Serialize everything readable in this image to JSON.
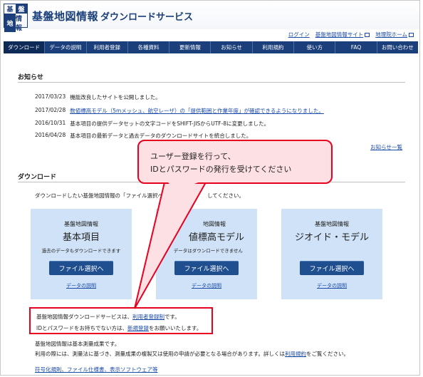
{
  "header": {
    "logo_chars": [
      "基",
      "盤",
      "地",
      "情報"
    ],
    "title": "基盤地図情報",
    "subtitle": "ダウンロードサービス"
  },
  "top_links": [
    "ログイン",
    "基盤地図情報サイト",
    "地理院ホーム"
  ],
  "nav": [
    "ダウンロード",
    "データの説明",
    "利用者登録",
    "各種資料",
    "更新情報",
    "お知らせ",
    "利用規約",
    "使い方",
    "FAQ",
    "お問い合わせ"
  ],
  "news": {
    "heading": "お知らせ",
    "items": [
      {
        "date": "2017/03/23",
        "text": "機能改良したサイトを公開しました。",
        "link": false
      },
      {
        "date": "2017/02/28",
        "text": "数値標高モデル（5mメッシュ、航空レーザ）の「提供範囲と作業年度」が確認できるようになりました。",
        "link": true
      },
      {
        "date": "2016/10/31",
        "text": "基本項目の提供データセットの文字コードをSHIFT-JISからUTF-8に変更しました。",
        "link": false
      },
      {
        "date": "2016/04/28",
        "text": "基本項目の最新データと過去データのダウンロードサイトを統合しました。",
        "link": false
      }
    ],
    "more": "お知らせ一覧"
  },
  "download": {
    "heading": "ダウンロード",
    "intro": "ダウンロードしたい基盤地図情報の「ファイル選択へ",
    "intro_tail": "してください。",
    "cards": [
      {
        "category": "基盤地図情報",
        "name": "基本項目",
        "desc": "過去のデータもダウンロードできます",
        "button": "ファイル選択へ",
        "link": "データの説明"
      },
      {
        "category": "地図情報",
        "name": "値標高モデル",
        "desc": "データはダウンロードできません",
        "button": "ファイル選択へ",
        "link": "データの説明"
      },
      {
        "category": "基盤地図情報",
        "name": "ジオイド・モデル",
        "desc": "",
        "button": "ファイル選択へ",
        "link": "データの説明"
      }
    ]
  },
  "notice": {
    "l1_a": "基盤地図情報ダウンロードサービスは、",
    "l1_link": "利用者登録制",
    "l1_b": "です。",
    "l2_a": "IDとパスワードをお持ちでない方は、",
    "l2_link": "新規登録",
    "l2_b": "をお願いいたします。"
  },
  "footer": {
    "l1": "基盤地図情報は基本測量成果です。",
    "l2_a": "利用の際には、測量法に基づき、測量成果の複製又は使用の申請が必要となる場合があります。詳しくは",
    "l2_link": "利用規約",
    "l2_b": "をご覧ください。",
    "l3": "符号化規則、ファイル仕様書、表示ソフトウェア等"
  },
  "callout": {
    "line1": "ユーザー登録を行って、",
    "line2": "IDとパスワードの発行を受けてください"
  },
  "colors": {
    "nav": "#1b3f7a",
    "callout_border": "#e8001f",
    "callout_fill": "#fde0e4",
    "card": "#cfe2f7"
  }
}
